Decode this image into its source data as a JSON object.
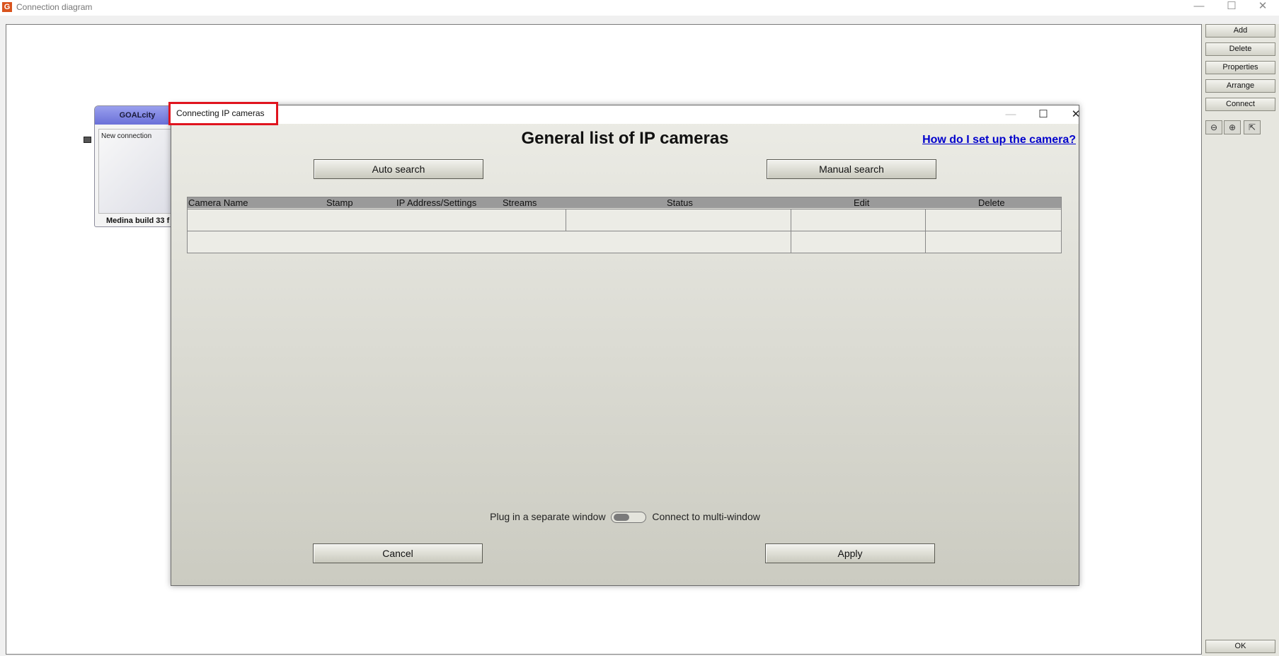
{
  "window": {
    "title": "Connection diagram",
    "icon_letter": "G",
    "controls": {
      "minimize": "—",
      "maximize": "☐",
      "close": "✕"
    }
  },
  "side_panel": {
    "buttons": [
      "Add",
      "Delete",
      "Properties",
      "Arrange",
      "Connect"
    ],
    "ok_label": "OK",
    "zoom_icons": [
      "zoom-out-icon",
      "zoom-in-icon",
      "fit-icon"
    ]
  },
  "node": {
    "header": "GOALcity",
    "connection_label": "New connection",
    "footer": "Medina build 33 f"
  },
  "dialog": {
    "title": "Connecting IP cameras",
    "heading": "General list of IP cameras",
    "help_link": "How do I set up the camera?",
    "auto_search": "Auto search",
    "manual_search": "Manual search",
    "table": {
      "columns": [
        "Camera Name",
        "Stamp",
        "IP Address/Settings",
        "Streams",
        "Status",
        "Edit",
        "Delete"
      ],
      "rows": [
        {
          "camera_name": "",
          "status": "",
          "edit": "",
          "delete": ""
        },
        {
          "camera_name": "",
          "status": "",
          "edit": "",
          "delete": ""
        }
      ]
    },
    "toggle_left_label": "Plug in a separate window",
    "toggle_right_label": "Connect to multi-window",
    "toggle_state": "off",
    "cancel": "Cancel",
    "apply": "Apply"
  }
}
